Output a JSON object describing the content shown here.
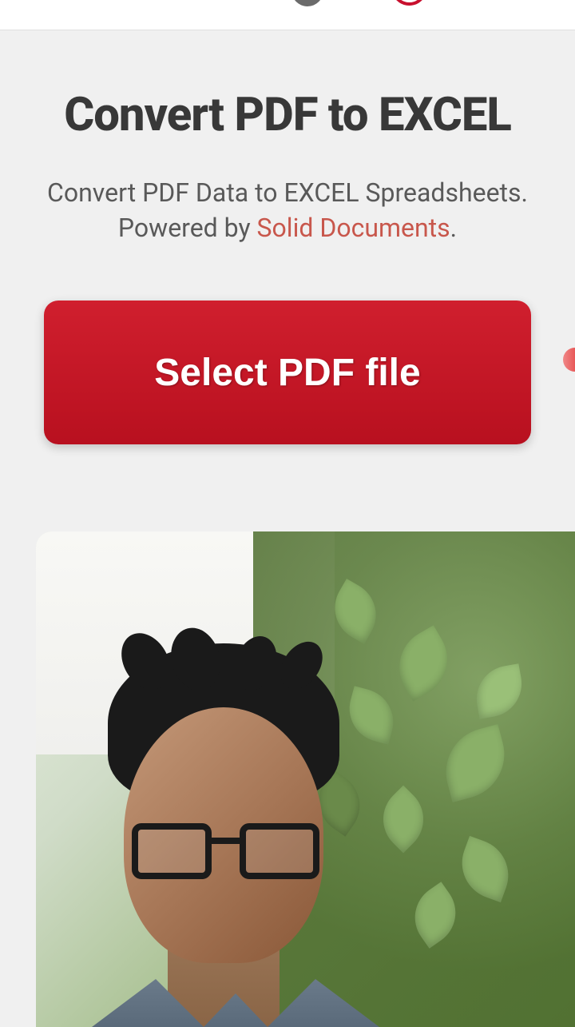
{
  "header": {
    "title": "Convert PDF to EXCEL",
    "subtitle": "Convert PDF Data to EXCEL Spreadsheets.",
    "powered_prefix": "Powered by ",
    "powered_link": "Solid Documents",
    "powered_suffix": "."
  },
  "actions": {
    "select_file_label": "Select PDF file"
  }
}
